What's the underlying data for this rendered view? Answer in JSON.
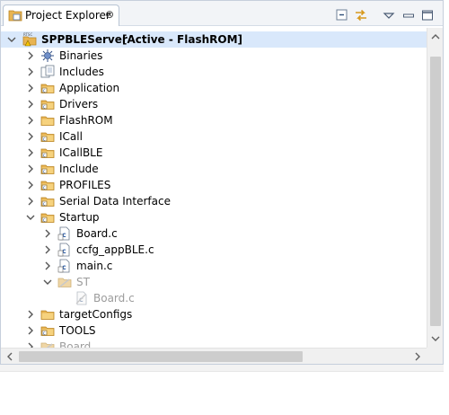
{
  "tab": {
    "label": "Project Explorer",
    "close": "⊗",
    "icon": "project-explorer-icon"
  },
  "toolbar": {
    "collapse_all": "collapse-all-icon",
    "link_with_editor": "link-with-editor-icon",
    "view_menu": "view-menu-icon",
    "minimize": "minimize-icon",
    "maximize": "maximize-icon"
  },
  "colors": {
    "accent": "#d9e8fb",
    "folder": "#e8b452",
    "dimmed": "#9c9c9c"
  },
  "project": {
    "name": "SPPBLEServer",
    "status": "[Active - FlashROM]"
  },
  "tree": {
    "binaries": "Binaries",
    "includes": "Includes",
    "application": "Application",
    "drivers": "Drivers",
    "flashrom": "FlashROM",
    "icall": "ICall",
    "icallble": "ICallBLE",
    "include": "Include",
    "profiles": "PROFILES",
    "serial": "Serial Data Interface",
    "startup": "Startup",
    "board_c": "Board.c",
    "ccfg": "ccfg_appBLE.c",
    "main_c": "main.c",
    "st": "ST",
    "st_board": "Board.c",
    "targetconfigs": "targetConfigs",
    "tools": "TOOLS",
    "board": "Board"
  }
}
